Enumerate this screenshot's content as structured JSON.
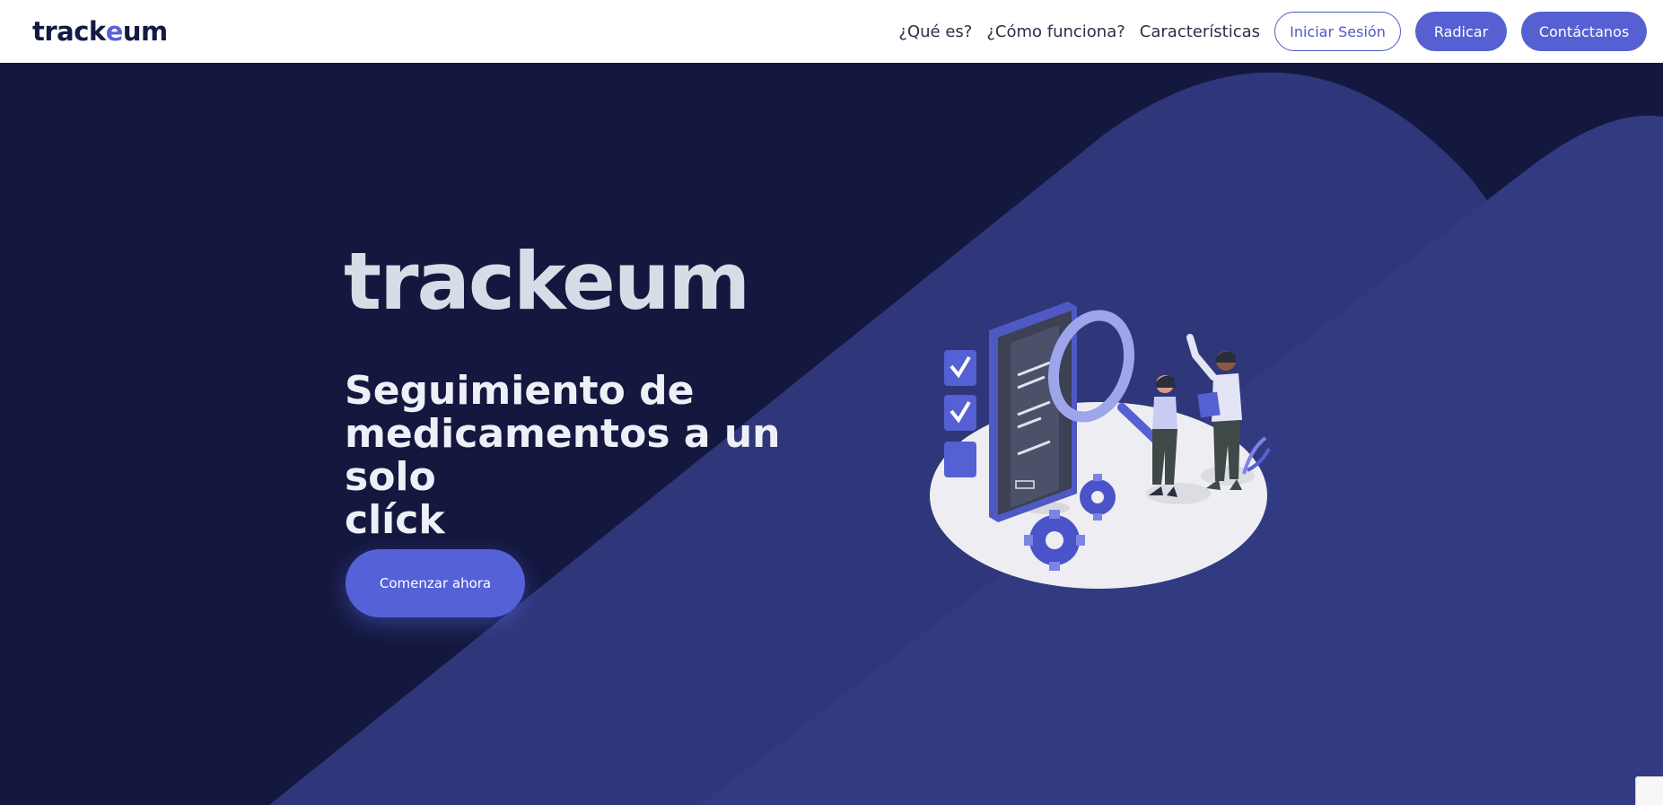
{
  "brand": {
    "logo_left": "track",
    "logo_accent": "e",
    "logo_right": "um",
    "colors": {
      "navy": "#14183f",
      "accent": "#5560d2",
      "band": "#2f3679",
      "logo_light": "#d6dde6"
    }
  },
  "nav": {
    "links": [
      "¿Qué es?",
      "¿Cómo funciona?",
      "Características"
    ],
    "login_label": "Iniciar Sesión",
    "radicar_label": "Radicar",
    "contact_label": "Contáctanos"
  },
  "hero": {
    "logo_left": "track",
    "logo_accent": "e",
    "logo_right": "um",
    "heading_lines": [
      "Seguimiento de",
      "medicamentos a un solo",
      "clíck"
    ],
    "cta_label": "Comenzar ahora"
  },
  "icons": {
    "illustration": "medicine-tracking-illustration",
    "recaptcha": "recaptcha-badge-icon"
  }
}
